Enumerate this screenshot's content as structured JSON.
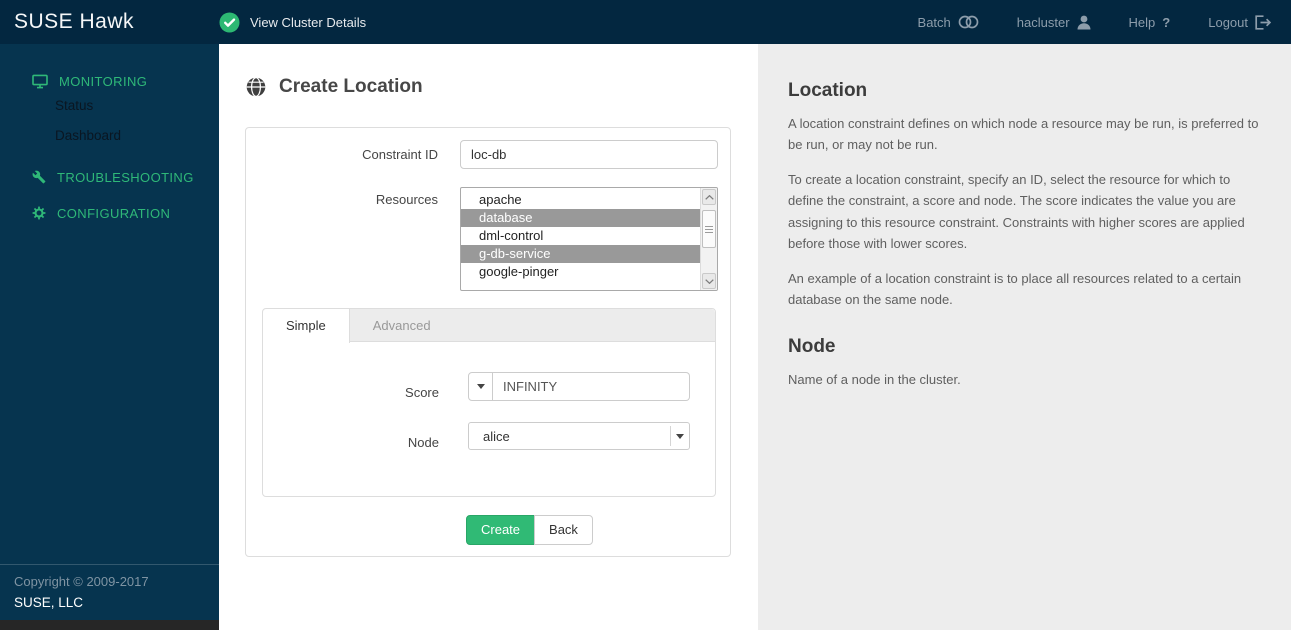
{
  "header": {
    "brand": "SUSE Hawk",
    "cluster_status": "View Cluster Details",
    "batch": "Batch",
    "user": "hacluster",
    "help": "Help",
    "help_glyph": "?",
    "logout": "Logout"
  },
  "sidebar": {
    "monitoring": "MONITORING",
    "status": "Status",
    "dashboard": "Dashboard",
    "troubleshooting": "TROUBLESHOOTING",
    "configuration": "CONFIGURATION",
    "copyright": "Copyright © 2009-2017",
    "company": "SUSE, LLC"
  },
  "main": {
    "title": "Create Location",
    "form": {
      "constraint_label": "Constraint ID",
      "constraint_value": "loc-db",
      "resources_label": "Resources",
      "resources": [
        {
          "label": "apache",
          "selected": false
        },
        {
          "label": "database",
          "selected": true
        },
        {
          "label": "dml-control",
          "selected": false
        },
        {
          "label": "g-db-service",
          "selected": true
        },
        {
          "label": "google-pinger",
          "selected": false
        }
      ],
      "tab_simple": "Simple",
      "tab_advanced": "Advanced",
      "score_label": "Score",
      "score_value": "INFINITY",
      "node_label": "Node",
      "node_value": "alice",
      "create": "Create",
      "back": "Back"
    }
  },
  "help": {
    "location_title": "Location",
    "location_p1": "A location constraint defines on which node a resource may be run, is preferred to be run, or may not be run.",
    "location_p2": "To create a location constraint, specify an ID, select the resource for which to define the constraint, a score and node. The score indicates the value you are assigning to this resource constraint. Constraints with higher scores are applied before those with lower scores.",
    "location_p3": "An example of a location constraint is to place all resources related to a certain database on the same node.",
    "node_title": "Node",
    "node_p": "Name of a node in the cluster."
  },
  "colors": {
    "accent_green": "#30ba78",
    "header_bg": "#032740",
    "sidebar_bg": "#06344f",
    "selected_item_bg": "#999999",
    "help_panel_bg": "#ededed"
  }
}
